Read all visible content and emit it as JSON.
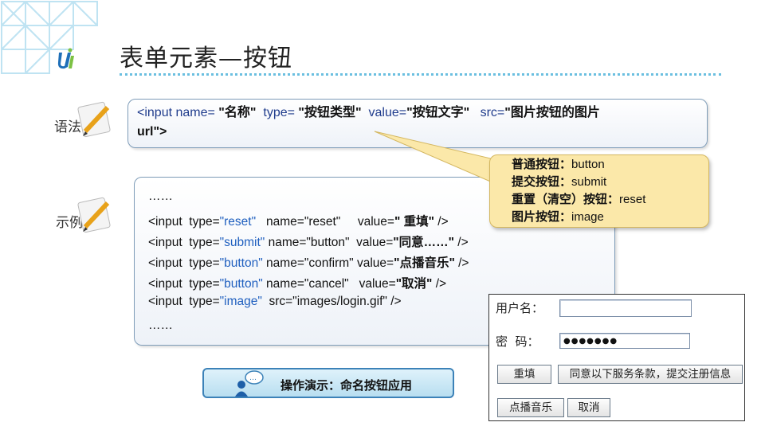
{
  "title": "表单元素—按钮",
  "logo_icon": "u-logo-icon",
  "syntax": {
    "label": "语法",
    "line1_prefix": "<input name= ",
    "name_val": "\"名称\"",
    "type_kw": "  type= ",
    "type_val": "\"按钮类型\"",
    "value_kw": "  value=",
    "value_val": "\"按钮文字\"",
    "src_kw": "   src=",
    "src_val": "\"图片按钮的图片",
    "line2": "url\">"
  },
  "example": {
    "label": "示例",
    "lines": [
      {
        "a": "……",
        "t": "",
        "b": "",
        "v": "",
        "c": ""
      },
      {
        "a": "<input  type=",
        "t": "\"reset\"",
        "b": "   name=\"reset\"     value=",
        "v": "\" 重填\"",
        "c": " />"
      },
      {
        "a": "<input  type=",
        "t": "\"submit\"",
        "b": " name=\"button\"  value=",
        "v": "\"同意……\"",
        "c": " />"
      },
      {
        "a": "<input  type=",
        "t": "\"button\"",
        "b": " name=\"confirm\" value=",
        "v": "\"点播音乐\"",
        "c": " />"
      },
      {
        "a": "<input  type=",
        "t": "\"button\"",
        "b": " name=\"cancel\"   value=",
        "v": "\"取消\"",
        "c": " />"
      },
      {
        "a": "<input  type=",
        "t": "\"image\"",
        "b": "  src=\"images/login.gif\" />",
        "v": "",
        "c": ""
      },
      {
        "a": "……",
        "t": "",
        "b": "",
        "v": "",
        "c": ""
      }
    ]
  },
  "callout": {
    "items": [
      {
        "label": "普通按钮：",
        "value": "button"
      },
      {
        "label": "提交按钮：",
        "value": "submit"
      },
      {
        "label": "重置（清空）按钮：",
        "value": "reset"
      },
      {
        "label": "图片按钮：",
        "value": "image"
      }
    ]
  },
  "demo_button": {
    "label": "操作演示：命名按钮应用",
    "icon": "user-chat-icon"
  },
  "form": {
    "username_label": "用户名：",
    "username_value": "",
    "password_label": "密  码：",
    "password_value": "●●●●●●●",
    "reset_label": "重填",
    "submit_label": "同意以下服务条款，提交注册信息",
    "music_label": "点播音乐",
    "cancel_label": "取消"
  },
  "colors": {
    "accent": "#6bbfe0",
    "keyword": "#1f3c8c",
    "type_value": "#1f5fbf",
    "callout_bg": "#fbe8a9"
  }
}
